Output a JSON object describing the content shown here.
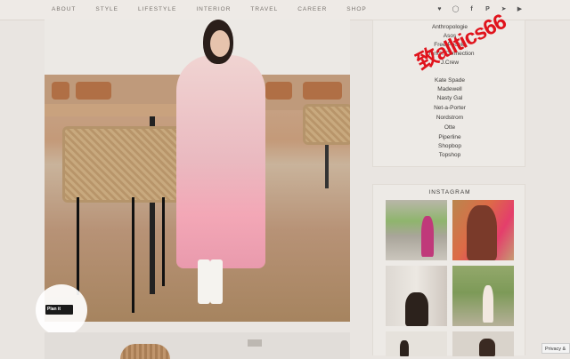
{
  "nav": {
    "links": [
      "ABOUT",
      "STYLE",
      "LIFESTYLE",
      "INTERIOR",
      "TRAVEL",
      "CAREER",
      "SHOP"
    ],
    "social_icons": [
      "heart-icon",
      "instagram-icon",
      "facebook-icon",
      "pinterest-icon",
      "twitter-icon",
      "youtube-icon"
    ]
  },
  "main": {
    "plan_it_label": "Plan it"
  },
  "sidebar": {
    "brands": [
      "Anthropologie",
      "Asos",
      "Free People",
      "French Connection",
      "J.Crew",
      "Kate Spade",
      "Madewell",
      "Nasty Gal",
      "Net-a-Porter",
      "Nordstrom",
      "Otte",
      "Piperline",
      "Shopbop",
      "Topshop"
    ],
    "instagram_title": "INSTAGRAM"
  },
  "watermark": "致alltics66",
  "privacy_label": "Privacy &"
}
